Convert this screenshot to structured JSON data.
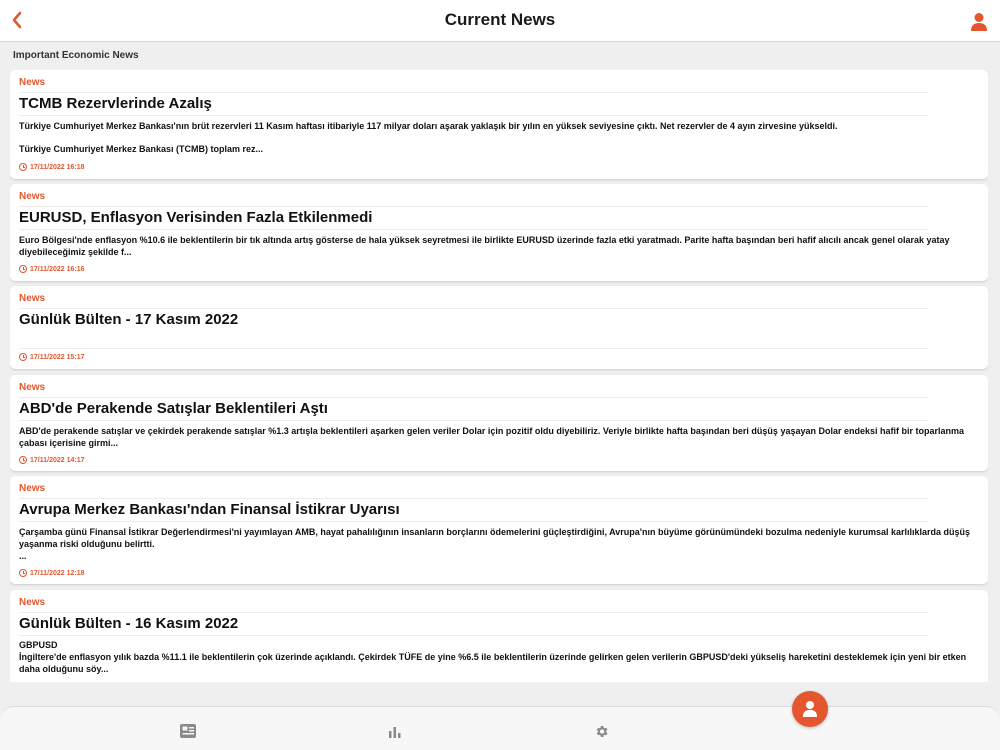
{
  "header": {
    "title": "Current News"
  },
  "section": {
    "title": "Important Economic News"
  },
  "colors": {
    "accent": "#e4572e",
    "background": "#efefef",
    "card": "#ffffff"
  },
  "news": [
    {
      "tag": "News",
      "title": "TCMB Rezervlerinde Azalış",
      "body": "Türkiye Cumhuriyet Merkez Bankası'nın brüt rezervleri 11 Kasım haftası itibariyle 117 milyar doları aşarak yaklaşık bir yılın en yüksek seviyesine çıktı. Net rezervler de 4 ayın zirvesine yükseldi.",
      "body2": "Türkiye Cumhuriyet Merkez Bankası (TCMB) toplam rez...",
      "time": "17/11/2022  16:18"
    },
    {
      "tag": "News",
      "title": "EURUSD, Enflasyon Verisinden Fazla Etkilenmedi",
      "body": "Euro Bölgesi'nde enflasyon %10.6 ile beklentilerin bir tık altında artış gösterse de hala yüksek seyretmesi ile birlikte EURUSD üzerinde fazla etki yaratmadı. Parite hafta başından beri hafif alıcılı ancak genel olarak yatay diyebileceğimiz şekilde f...",
      "time": "17/11/2022  16:16"
    },
    {
      "tag": "News",
      "title": "Günlük Bülten - 17 Kasım 2022",
      "body": "",
      "time": "17/11/2022  15:17"
    },
    {
      "tag": "News",
      "title": "ABD'de Perakende Satışlar Beklentileri Aştı",
      "body": "ABD'de perakende satışlar ve çekirdek perakende satışlar %1.3 artışla beklentileri aşarken gelen veriler Dolar için pozitif oldu diyebiliriz. Veriyle birlikte hafta başından beri düşüş yaşayan Dolar endeksi hafif bir toparlanma çabası içerisine girmi...",
      "time": "17/11/2022  14:17"
    },
    {
      "tag": "News",
      "title": "Avrupa Merkez Bankası'ndan Finansal İstikrar Uyarısı",
      "body": "Çarşamba günü Finansal İstikrar Değerlendirmesi'ni yayımlayan AMB, hayat pahalılığının insanların borçlarını ödemelerini güçleştirdiğini, Avrupa'nın büyüme görünümündeki bozulma nedeniyle kurumsal karlılıklarda düşüş yaşanma riski olduğunu belirtti.",
      "body2": "...",
      "time": "17/11/2022  12:18"
    },
    {
      "tag": "News",
      "title": "Günlük Bülten - 16 Kasım 2022",
      "body": "GBPUSD",
      "body2": "İngiltere'de enflasyon yılık bazda %11.1 ile beklentilerin çok üzerinde açıklandı. Çekirdek TÜFE de yine %6.5 ile beklentilerin üzerinde gelirken gelen verilerin GBPUSD'deki yükseliş hareketini desteklemek için yeni bir etken daha olduğunu söy...",
      "time": ""
    }
  ],
  "tabbar": {
    "icons": [
      "newspaper-icon",
      "bar-chart-icon",
      "gear-icon"
    ],
    "fab_icon": "user-icon"
  }
}
